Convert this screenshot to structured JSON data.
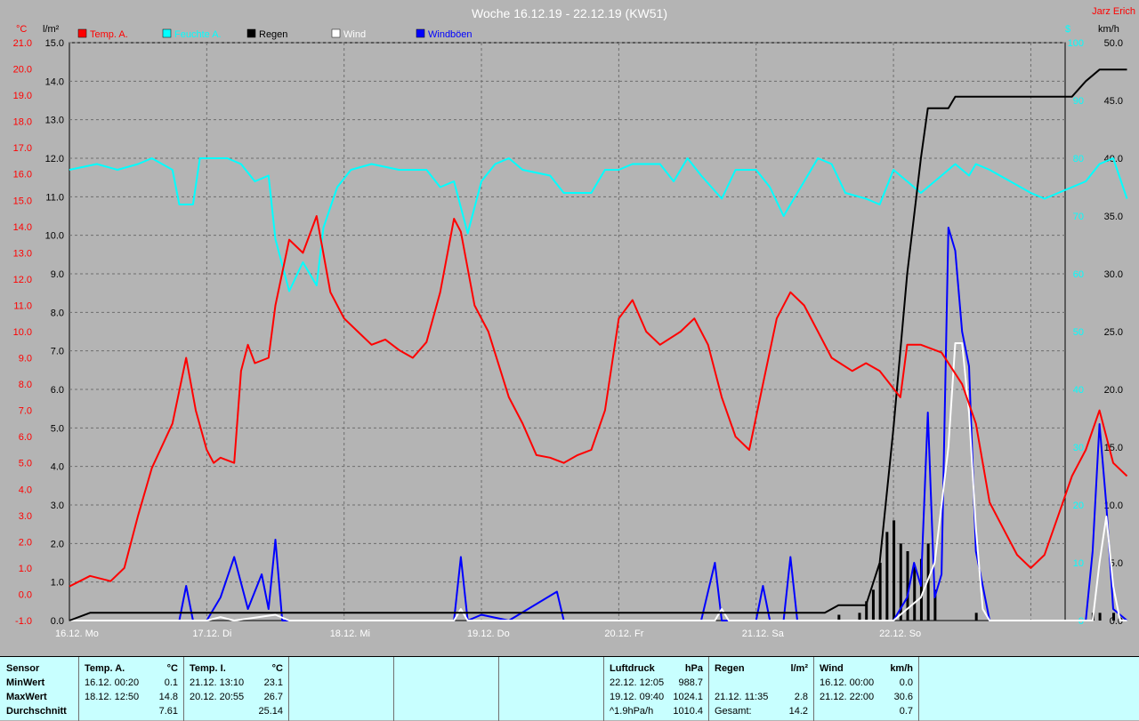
{
  "title": "Woche 16.12.19 - 22.12.19 (KW51)",
  "author": "Jarz Erich",
  "axis_units": {
    "temp": "°C",
    "rain": "l/m²",
    "pressure": "$",
    "wind": "km/h"
  },
  "legend": [
    {
      "label": "Temp. A.",
      "color": "#ff0000"
    },
    {
      "label": "Feuchte A.",
      "color": "#00ffff"
    },
    {
      "label": "Regen",
      "color": "#000000"
    },
    {
      "label": "Wind",
      "color": "#ffffff"
    },
    {
      "label": "Windböen",
      "color": "#0000ff"
    }
  ],
  "chart_data": {
    "type": "line",
    "title": "Woche 16.12.19 - 22.12.19 (KW51)",
    "x_labels": [
      "16.12. Mo",
      "17.12. Di",
      "18.12. Mi",
      "19.12. Do",
      "20.12. Fr",
      "21.12. Sa",
      "22.12. So"
    ],
    "x_range_days": [
      0,
      7
    ],
    "temp_axis": {
      "min": -1.0,
      "max": 21.0,
      "ticks": [
        "-1.0",
        "0.0",
        "1.0",
        "2.0",
        "3.0",
        "4.0",
        "5.0",
        "6.0",
        "7.0",
        "8.0",
        "9.0",
        "10.0",
        "11.0",
        "12.0",
        "13.0",
        "14.0",
        "15.0",
        "16.0",
        "17.0",
        "18.0",
        "19.0",
        "20.0",
        "21.0"
      ]
    },
    "rain_axis": {
      "min": 0.0,
      "max": 15.0,
      "ticks": [
        "0.0",
        "1.0",
        "2.0",
        "3.0",
        "4.0",
        "5.0",
        "6.0",
        "7.0",
        "8.0",
        "9.0",
        "10.0",
        "11.0",
        "12.0",
        "13.0",
        "14.0",
        "15.0"
      ]
    },
    "humidity_axis": {
      "min": 0,
      "max": 100,
      "ticks": [
        "0",
        "10",
        "20",
        "30",
        "40",
        "50",
        "60",
        "70",
        "80",
        "90",
        "100"
      ]
    },
    "wind_axis": {
      "min": 0.0,
      "max": 50.0,
      "ticks": [
        "0.0",
        "5.0",
        "10.0",
        "15.0",
        "20.0",
        "25.0",
        "30.0",
        "35.0",
        "40.0",
        "45.0",
        "50.0"
      ]
    },
    "grid": true,
    "series": [
      {
        "name": "Temp. A.",
        "color": "#ff0000",
        "axis": "temp",
        "points": [
          [
            0,
            0.3
          ],
          [
            0.15,
            0.7
          ],
          [
            0.3,
            0.5
          ],
          [
            0.4,
            1.0
          ],
          [
            0.5,
            3.0
          ],
          [
            0.6,
            4.8
          ],
          [
            0.75,
            6.5
          ],
          [
            0.85,
            9.0
          ],
          [
            0.92,
            7.0
          ],
          [
            1.0,
            5.5
          ],
          [
            1.05,
            5.0
          ],
          [
            1.1,
            5.2
          ],
          [
            1.2,
            5.0
          ],
          [
            1.25,
            8.5
          ],
          [
            1.3,
            9.5
          ],
          [
            1.35,
            8.8
          ],
          [
            1.45,
            9.0
          ],
          [
            1.5,
            11.0
          ],
          [
            1.6,
            13.5
          ],
          [
            1.7,
            13.0
          ],
          [
            1.8,
            14.4
          ],
          [
            1.9,
            11.5
          ],
          [
            2.0,
            10.5
          ],
          [
            2.1,
            10.0
          ],
          [
            2.2,
            9.5
          ],
          [
            2.3,
            9.7
          ],
          [
            2.4,
            9.3
          ],
          [
            2.5,
            9.0
          ],
          [
            2.6,
            9.6
          ],
          [
            2.7,
            11.5
          ],
          [
            2.8,
            14.3
          ],
          [
            2.85,
            13.8
          ],
          [
            2.95,
            11.0
          ],
          [
            3.05,
            10.0
          ],
          [
            3.2,
            7.5
          ],
          [
            3.3,
            6.5
          ],
          [
            3.4,
            5.3
          ],
          [
            3.5,
            5.2
          ],
          [
            3.6,
            5.0
          ],
          [
            3.7,
            5.3
          ],
          [
            3.8,
            5.5
          ],
          [
            3.9,
            7.0
          ],
          [
            4.0,
            10.5
          ],
          [
            4.1,
            11.2
          ],
          [
            4.2,
            10.0
          ],
          [
            4.3,
            9.5
          ],
          [
            4.45,
            10.0
          ],
          [
            4.55,
            10.5
          ],
          [
            4.65,
            9.5
          ],
          [
            4.75,
            7.5
          ],
          [
            4.85,
            6.0
          ],
          [
            4.95,
            5.5
          ],
          [
            5.05,
            8.0
          ],
          [
            5.15,
            10.5
          ],
          [
            5.25,
            11.5
          ],
          [
            5.35,
            11.0
          ],
          [
            5.45,
            10.0
          ],
          [
            5.55,
            9.0
          ],
          [
            5.7,
            8.5
          ],
          [
            5.8,
            8.8
          ],
          [
            5.9,
            8.5
          ],
          [
            6.05,
            7.5
          ],
          [
            6.1,
            9.5
          ],
          [
            6.2,
            9.5
          ],
          [
            6.35,
            9.2
          ],
          [
            6.5,
            8.0
          ],
          [
            6.6,
            6.5
          ],
          [
            6.7,
            3.5
          ],
          [
            6.8,
            2.5
          ],
          [
            6.9,
            1.5
          ],
          [
            7.0,
            1.0
          ],
          [
            7.1,
            1.5
          ],
          [
            7.2,
            3.0
          ],
          [
            7.3,
            4.5
          ],
          [
            7.4,
            5.5
          ],
          [
            7.5,
            7.0
          ],
          [
            7.6,
            5.0
          ],
          [
            7.7,
            4.5
          ]
        ]
      },
      {
        "name": "Feuchte A.",
        "color": "#00ffff",
        "axis": "humidity",
        "points": [
          [
            0,
            78
          ],
          [
            0.2,
            79
          ],
          [
            0.35,
            78
          ],
          [
            0.5,
            79
          ],
          [
            0.6,
            80
          ],
          [
            0.75,
            78
          ],
          [
            0.8,
            72
          ],
          [
            0.9,
            72
          ],
          [
            0.95,
            80
          ],
          [
            1.05,
            80
          ],
          [
            1.15,
            80
          ],
          [
            1.25,
            79
          ],
          [
            1.35,
            76
          ],
          [
            1.45,
            77
          ],
          [
            1.5,
            66
          ],
          [
            1.6,
            57
          ],
          [
            1.7,
            62
          ],
          [
            1.8,
            58
          ],
          [
            1.85,
            68
          ],
          [
            1.95,
            75
          ],
          [
            2.05,
            78
          ],
          [
            2.2,
            79
          ],
          [
            2.4,
            78
          ],
          [
            2.6,
            78
          ],
          [
            2.7,
            75
          ],
          [
            2.8,
            76
          ],
          [
            2.9,
            67
          ],
          [
            3.0,
            76
          ],
          [
            3.1,
            79
          ],
          [
            3.2,
            80
          ],
          [
            3.3,
            78
          ],
          [
            3.5,
            77
          ],
          [
            3.6,
            74
          ],
          [
            3.7,
            74
          ],
          [
            3.8,
            74
          ],
          [
            3.9,
            78
          ],
          [
            4.0,
            78
          ],
          [
            4.1,
            79
          ],
          [
            4.3,
            79
          ],
          [
            4.4,
            76
          ],
          [
            4.5,
            80
          ],
          [
            4.6,
            77
          ],
          [
            4.75,
            73
          ],
          [
            4.85,
            78
          ],
          [
            5.0,
            78
          ],
          [
            5.1,
            75
          ],
          [
            5.2,
            70
          ],
          [
            5.3,
            74
          ],
          [
            5.45,
            80
          ],
          [
            5.55,
            79
          ],
          [
            5.65,
            74
          ],
          [
            5.8,
            73
          ],
          [
            5.9,
            72
          ],
          [
            6.0,
            78
          ],
          [
            6.1,
            76
          ],
          [
            6.2,
            74
          ],
          [
            6.3,
            76
          ],
          [
            6.45,
            79
          ],
          [
            6.55,
            77
          ],
          [
            6.6,
            79
          ],
          [
            6.7,
            78
          ],
          [
            6.85,
            76
          ],
          [
            7.0,
            74
          ],
          [
            7.1,
            73
          ],
          [
            7.2,
            74
          ],
          [
            7.3,
            75
          ],
          [
            7.4,
            76
          ],
          [
            7.5,
            79
          ],
          [
            7.6,
            80
          ],
          [
            7.7,
            73
          ]
        ]
      },
      {
        "name": "Regen",
        "color": "#000000",
        "axis": "rain",
        "points": [
          [
            0,
            0
          ],
          [
            0.15,
            0.2
          ],
          [
            1.0,
            0.2
          ],
          [
            2.0,
            0.2
          ],
          [
            3.0,
            0.2
          ],
          [
            4.0,
            0.2
          ],
          [
            5.0,
            0.2
          ],
          [
            5.5,
            0.2
          ],
          [
            5.6,
            0.4
          ],
          [
            5.8,
            0.4
          ],
          [
            5.9,
            1.5
          ],
          [
            6.0,
            5.0
          ],
          [
            6.1,
            9.0
          ],
          [
            6.2,
            12.0
          ],
          [
            6.25,
            13.3
          ],
          [
            6.4,
            13.3
          ],
          [
            6.45,
            13.6
          ],
          [
            6.6,
            13.6
          ],
          [
            7.0,
            13.6
          ],
          [
            7.3,
            13.6
          ],
          [
            7.4,
            14.0
          ],
          [
            7.5,
            14.3
          ],
          [
            7.7,
            14.3
          ]
        ]
      },
      {
        "name": "Wind",
        "color": "#ffffff",
        "axis": "wind",
        "points": [
          [
            0,
            0
          ],
          [
            1.0,
            0
          ],
          [
            1.1,
            0.3
          ],
          [
            1.2,
            0
          ],
          [
            1.5,
            0.5
          ],
          [
            1.6,
            0
          ],
          [
            2.8,
            0
          ],
          [
            2.85,
            1.0
          ],
          [
            2.9,
            0
          ],
          [
            4.7,
            0
          ],
          [
            4.75,
            1.0
          ],
          [
            4.8,
            0
          ],
          [
            6.0,
            0
          ],
          [
            6.1,
            1.0
          ],
          [
            6.2,
            2.0
          ],
          [
            6.3,
            5.0
          ],
          [
            6.4,
            15.0
          ],
          [
            6.45,
            24.0
          ],
          [
            6.5,
            24.0
          ],
          [
            6.55,
            18.0
          ],
          [
            6.6,
            8.0
          ],
          [
            6.65,
            1.0
          ],
          [
            6.7,
            0
          ],
          [
            7.45,
            0
          ],
          [
            7.5,
            5.0
          ],
          [
            7.55,
            9.0
          ],
          [
            7.6,
            3.0
          ],
          [
            7.65,
            0
          ],
          [
            7.7,
            0
          ]
        ]
      },
      {
        "name": "Windböen",
        "color": "#0000ff",
        "axis": "wind",
        "points": [
          [
            0,
            0
          ],
          [
            0.8,
            0
          ],
          [
            0.85,
            3.0
          ],
          [
            0.9,
            0
          ],
          [
            1.0,
            0
          ],
          [
            1.1,
            2.0
          ],
          [
            1.2,
            5.5
          ],
          [
            1.3,
            1.0
          ],
          [
            1.4,
            4.0
          ],
          [
            1.45,
            1.0
          ],
          [
            1.5,
            7.0
          ],
          [
            1.55,
            0
          ],
          [
            2.8,
            0
          ],
          [
            2.85,
            5.5
          ],
          [
            2.9,
            0
          ],
          [
            3.0,
            0.5
          ],
          [
            3.2,
            0
          ],
          [
            3.55,
            2.5
          ],
          [
            3.6,
            0
          ],
          [
            4.6,
            0
          ],
          [
            4.7,
            5.0
          ],
          [
            4.75,
            0
          ],
          [
            5.0,
            0
          ],
          [
            5.05,
            3.0
          ],
          [
            5.1,
            0
          ],
          [
            5.2,
            0
          ],
          [
            5.25,
            5.5
          ],
          [
            5.3,
            0
          ],
          [
            6.0,
            0
          ],
          [
            6.1,
            2.0
          ],
          [
            6.15,
            5.0
          ],
          [
            6.2,
            3.0
          ],
          [
            6.25,
            18.0
          ],
          [
            6.3,
            2.0
          ],
          [
            6.35,
            4.0
          ],
          [
            6.4,
            34.0
          ],
          [
            6.45,
            32.0
          ],
          [
            6.5,
            25.0
          ],
          [
            6.55,
            22.0
          ],
          [
            6.6,
            6.0
          ],
          [
            6.7,
            0
          ],
          [
            7.4,
            0
          ],
          [
            7.45,
            6.0
          ],
          [
            7.5,
            17.0
          ],
          [
            7.55,
            10.0
          ],
          [
            7.6,
            1.0
          ],
          [
            7.7,
            0
          ]
        ]
      }
    ],
    "rain_bars": [
      {
        "x": 5.6,
        "value": 0.15
      },
      {
        "x": 5.75,
        "value": 0.2
      },
      {
        "x": 5.8,
        "value": 0.5
      },
      {
        "x": 5.85,
        "value": 0.8
      },
      {
        "x": 5.9,
        "value": 1.5
      },
      {
        "x": 5.95,
        "value": 2.3
      },
      {
        "x": 6.0,
        "value": 2.6
      },
      {
        "x": 6.05,
        "value": 2.0
      },
      {
        "x": 6.1,
        "value": 1.8
      },
      {
        "x": 6.15,
        "value": 1.4
      },
      {
        "x": 6.2,
        "value": 1.6
      },
      {
        "x": 6.25,
        "value": 2.0
      },
      {
        "x": 6.3,
        "value": 0.8
      },
      {
        "x": 6.6,
        "value": 0.2
      },
      {
        "x": 7.45,
        "value": 0.2
      },
      {
        "x": 7.5,
        "value": 0.2
      },
      {
        "x": 7.6,
        "value": 0.2
      }
    ]
  },
  "stats": {
    "sensor": {
      "header": "Sensor",
      "rows": [
        "MinWert",
        "MaxWert",
        "Durchschnitt"
      ]
    },
    "temp_a": {
      "header": "Temp. A.",
      "unit": "°C",
      "rows": [
        {
          "date": "16.12.  00:20",
          "value": "0.1"
        },
        {
          "date": "18.12.  12:50",
          "value": "14.8"
        },
        {
          "date": "",
          "value": "7.61"
        }
      ]
    },
    "temp_i": {
      "header": "Temp. I.",
      "unit": "°C",
      "rows": [
        {
          "date": "21.12.  13:10",
          "value": "23.1"
        },
        {
          "date": "20.12.  20:55",
          "value": "26.7"
        },
        {
          "date": "",
          "value": "25.14"
        }
      ]
    },
    "pressure": {
      "header": "Luftdruck",
      "unit": "hPa",
      "rows": [
        {
          "date": "22.12.  12:05",
          "value": "988.7"
        },
        {
          "date": "19.12.  09:40",
          "value": "1024.1"
        },
        {
          "date": "^1.9hPa/h",
          "value": "1010.4"
        }
      ]
    },
    "rain": {
      "header": "Regen",
      "unit": "l/m²",
      "rows": [
        {
          "date": "",
          "value": ""
        },
        {
          "date": "21.12.  11:35",
          "value": "2.8"
        },
        {
          "date": "Gesamt:",
          "value": "14.2"
        }
      ]
    },
    "wind": {
      "header": "Wind",
      "unit": "km/h",
      "rows": [
        {
          "date": "16.12.  00:00",
          "value": "0.0"
        },
        {
          "date": "21.12.  22:00",
          "value": "30.6"
        },
        {
          "date": "",
          "value": "0.7"
        }
      ]
    }
  }
}
